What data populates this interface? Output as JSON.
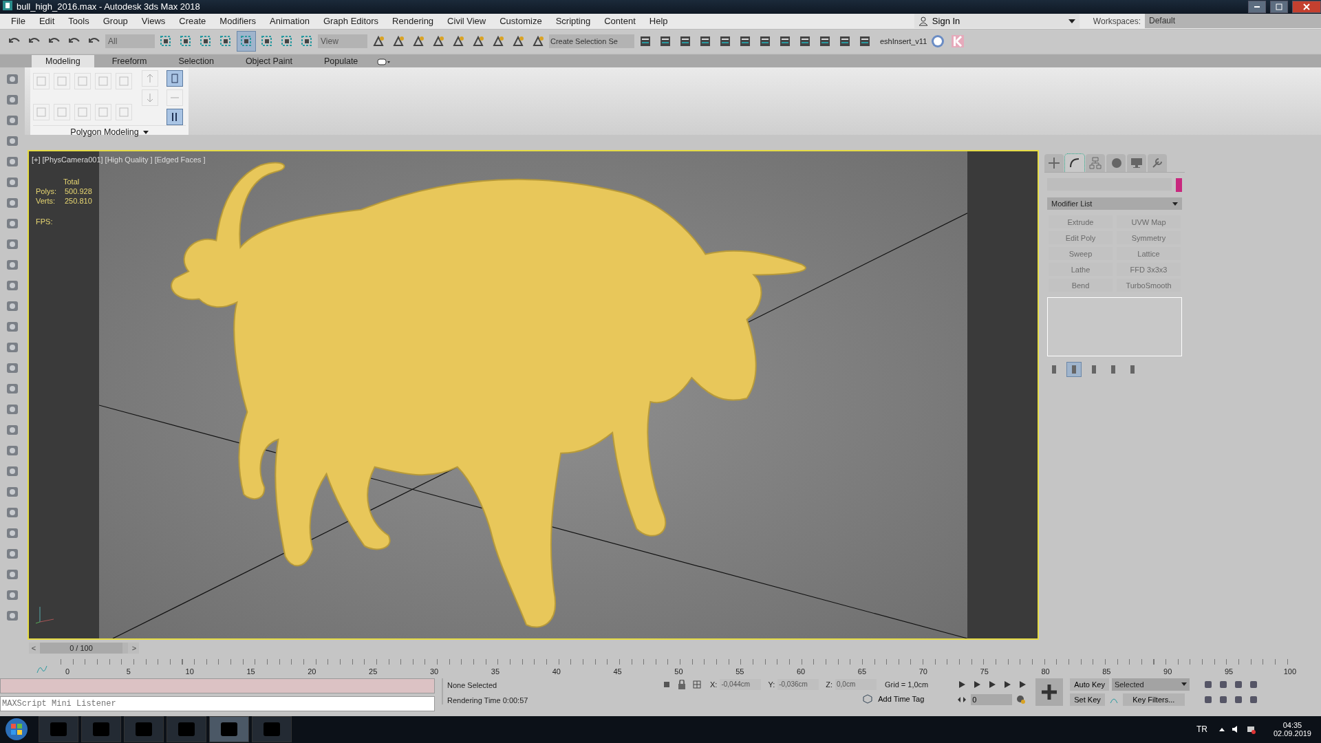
{
  "window": {
    "title": "bull_high_2016.max - Autodesk 3ds Max 2018"
  },
  "menu": [
    "File",
    "Edit",
    "Tools",
    "Group",
    "Views",
    "Create",
    "Modifiers",
    "Animation",
    "Graph Editors",
    "Rendering",
    "Civil View",
    "Customize",
    "Scripting",
    "Content",
    "Help"
  ],
  "account": {
    "sign_in": "Sign In",
    "workspaces_label": "Workspaces:",
    "workspace": "Default"
  },
  "toolbar": {
    "selection_filter": "All",
    "reference_coordinate": "View",
    "named_selection_placeholder": "Create Selection Se",
    "script_label": "eshInsert_v11"
  },
  "ribbon": {
    "tabs": [
      {
        "label": "Modeling",
        "selected": true
      },
      {
        "label": "Freeform",
        "selected": false
      },
      {
        "label": "Selection",
        "selected": false
      },
      {
        "label": "Object Paint",
        "selected": false
      },
      {
        "label": "Populate",
        "selected": false
      }
    ],
    "panel_title": "Polygon Modeling"
  },
  "viewport": {
    "labels": [
      "[+]",
      "[PhysCamera001]",
      "[High Quality ]",
      "[Edged Faces ]"
    ],
    "stats_header": "Total",
    "stats": [
      {
        "label": "Polys:",
        "value": "500.928"
      },
      {
        "label": "Verts:",
        "value": "250.810"
      }
    ],
    "fps_label": "FPS:"
  },
  "command_panel": {
    "tabs": [
      {
        "kind": "create",
        "selected": false
      },
      {
        "kind": "modify",
        "selected": true
      },
      {
        "kind": "hierarchy",
        "selected": false
      },
      {
        "kind": "motion",
        "selected": false
      },
      {
        "kind": "display",
        "selected": false
      },
      {
        "kind": "utilities",
        "selected": false
      }
    ],
    "object_swatch": {
      "color": "#c8287e"
    },
    "modifier_list": "Modifier List",
    "modifier_buttons": [
      "Extrude",
      "UVW Map",
      "Edit Poly",
      "Symmetry",
      "Sweep",
      "Lattice",
      "Lathe",
      "FFD 3x3x3",
      "Bend",
      "TurboSmooth"
    ]
  },
  "timeline": {
    "slider": {
      "text": "0 / 100",
      "prev": "<",
      "next": ">",
      "level": 0
    },
    "ticks": [
      "0",
      "5",
      "10",
      "15",
      "20",
      "25",
      "30",
      "35",
      "40",
      "45",
      "50",
      "55",
      "60",
      "65",
      "70",
      "75",
      "80",
      "85",
      "90",
      "95",
      "100"
    ]
  },
  "status": {
    "listener_placeholder": "MAXScript Mini Listener",
    "selection": "None Selected",
    "render_time": "Rendering Time  0:00:57",
    "coords": [
      {
        "label": "X:",
        "value": "-0,044cm"
      },
      {
        "label": "Y:",
        "value": "-0,036cm"
      },
      {
        "label": "Z:",
        "value": "0,0cm"
      }
    ],
    "grid": "Grid = 1,0cm",
    "time_tag": "Add Time Tag",
    "frame": "0",
    "auto_key": "Auto Key",
    "key_mode": "Selected",
    "set_key": "Set Key",
    "key_filters": "Key Filters..."
  },
  "taskbar": {
    "language": "TR",
    "time": "04:35",
    "date": "02.09.2019"
  }
}
